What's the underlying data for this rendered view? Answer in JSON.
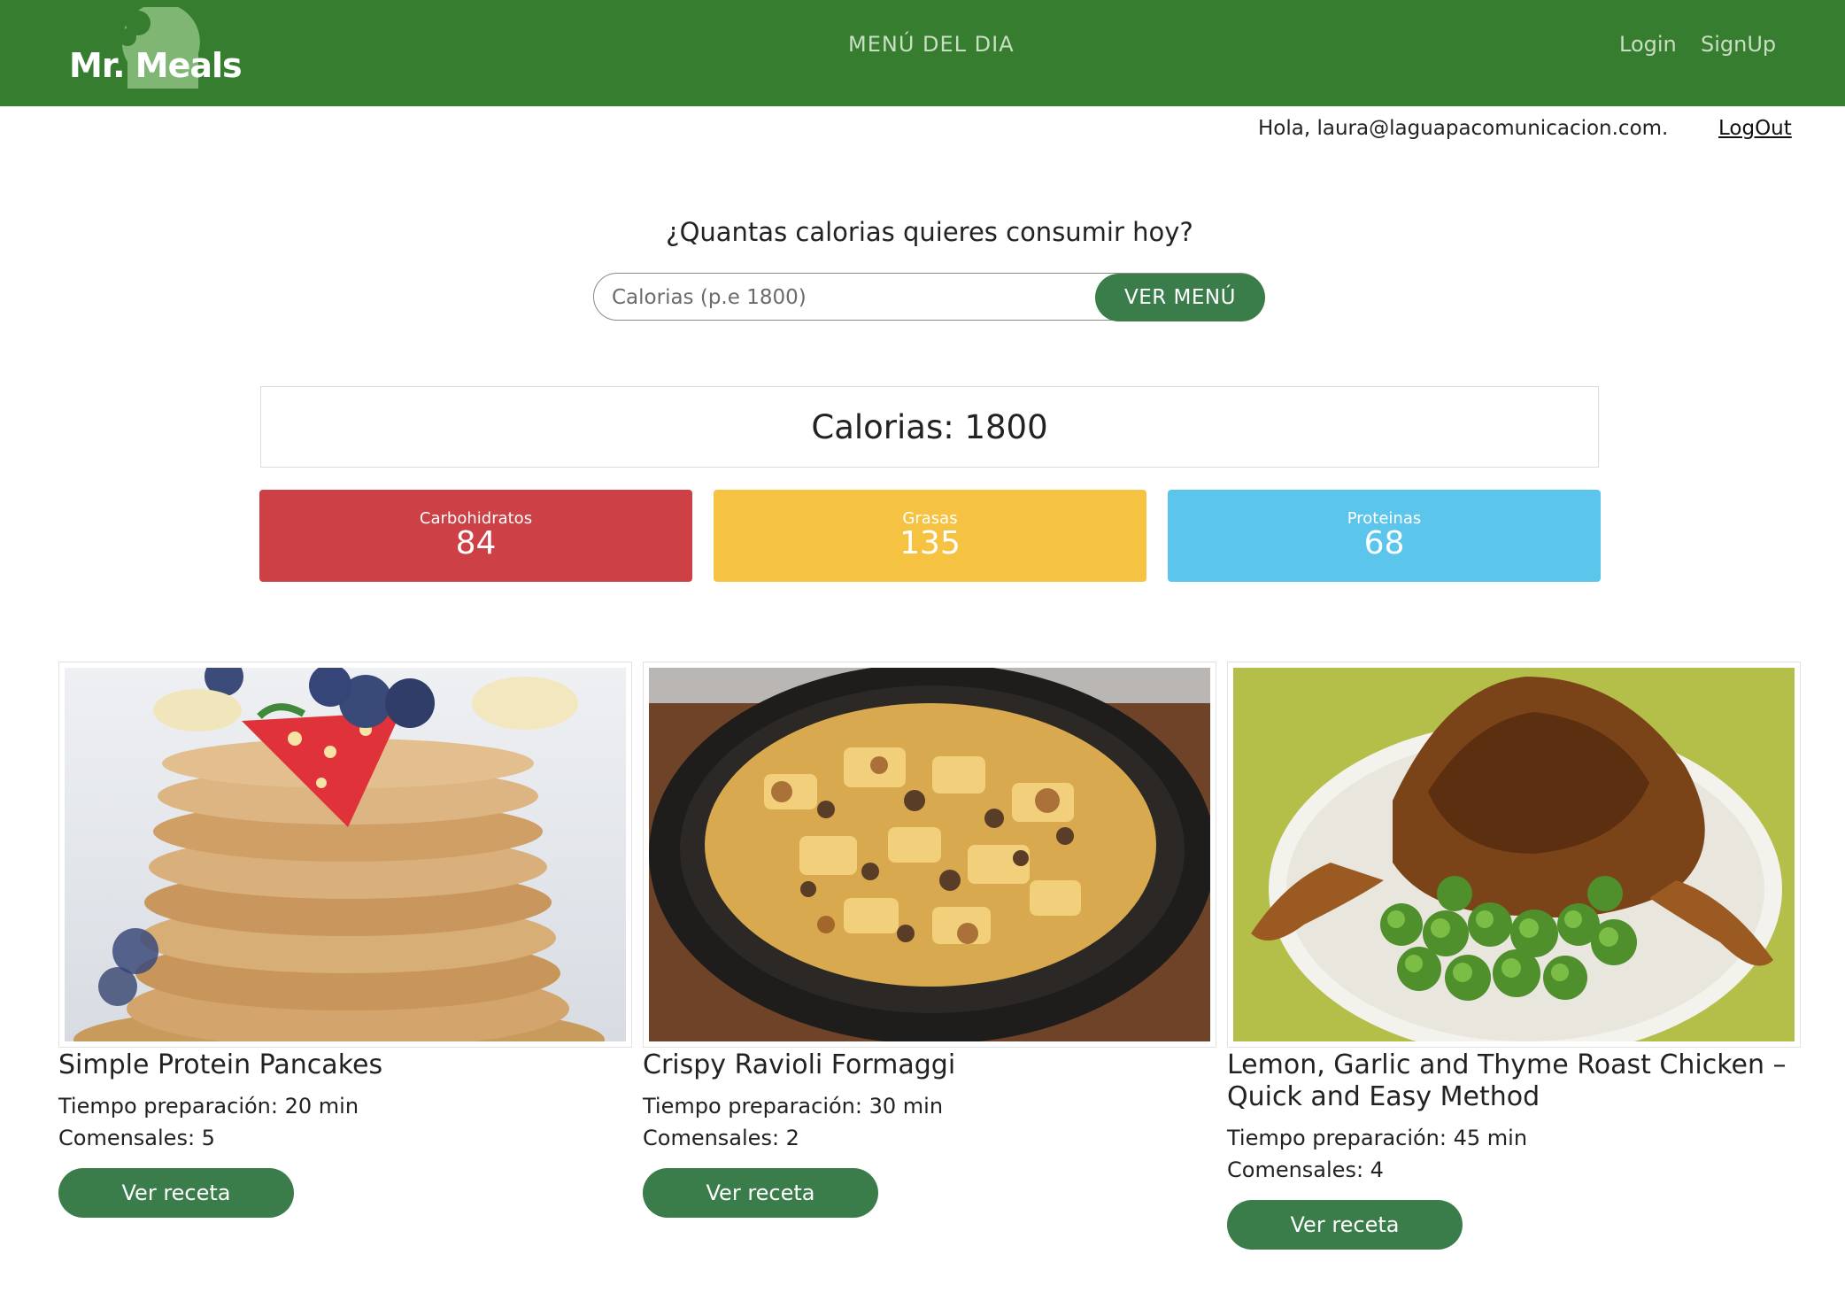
{
  "brand": {
    "logo_text": "Mr. Meals"
  },
  "nav": {
    "center_label": "MENÚ DEL DIA",
    "login_label": "Login",
    "signup_label": "SignUp"
  },
  "user_bar": {
    "greeting": "Hola, laura@laguapacomunicacion.com.",
    "logout_label": "LogOut"
  },
  "calorie_form": {
    "question": "¿Quantas calorias quieres consumir hoy?",
    "input_placeholder": "Calorias (p.e 1800)",
    "input_value": "",
    "submit_label": "VER MENÚ"
  },
  "summary": {
    "calories_text": "Calorias: 1800"
  },
  "macros": [
    {
      "label": "Carbohidratos",
      "value": "84",
      "color": "#cd4046"
    },
    {
      "label": "Grasas",
      "value": "135",
      "color": "#f5c242"
    },
    {
      "label": "Proteinas",
      "value": "68",
      "color": "#5bc5ec"
    }
  ],
  "recipes": [
    {
      "title": "Simple Protein Pancakes",
      "prep": "Tiempo preparación: 20 min",
      "servings": "Comensales: 5",
      "button_label": "Ver receta",
      "image": "pancakes-photo"
    },
    {
      "title": "Crispy Ravioli Formaggi",
      "prep": "Tiempo preparación: 30 min",
      "servings": "Comensales: 2",
      "button_label": "Ver receta",
      "image": "ravioli-skillet-photo"
    },
    {
      "title": "Lemon, Garlic and Thyme Roast Chicken – Quick and Easy Method",
      "prep": "Tiempo preparación: 45 min",
      "servings": "Comensales: 4",
      "button_label": "Ver receta",
      "image": "roast-chicken-photo"
    }
  ],
  "colors": {
    "navbar": "#377d2f",
    "button": "#3a7d4b"
  }
}
